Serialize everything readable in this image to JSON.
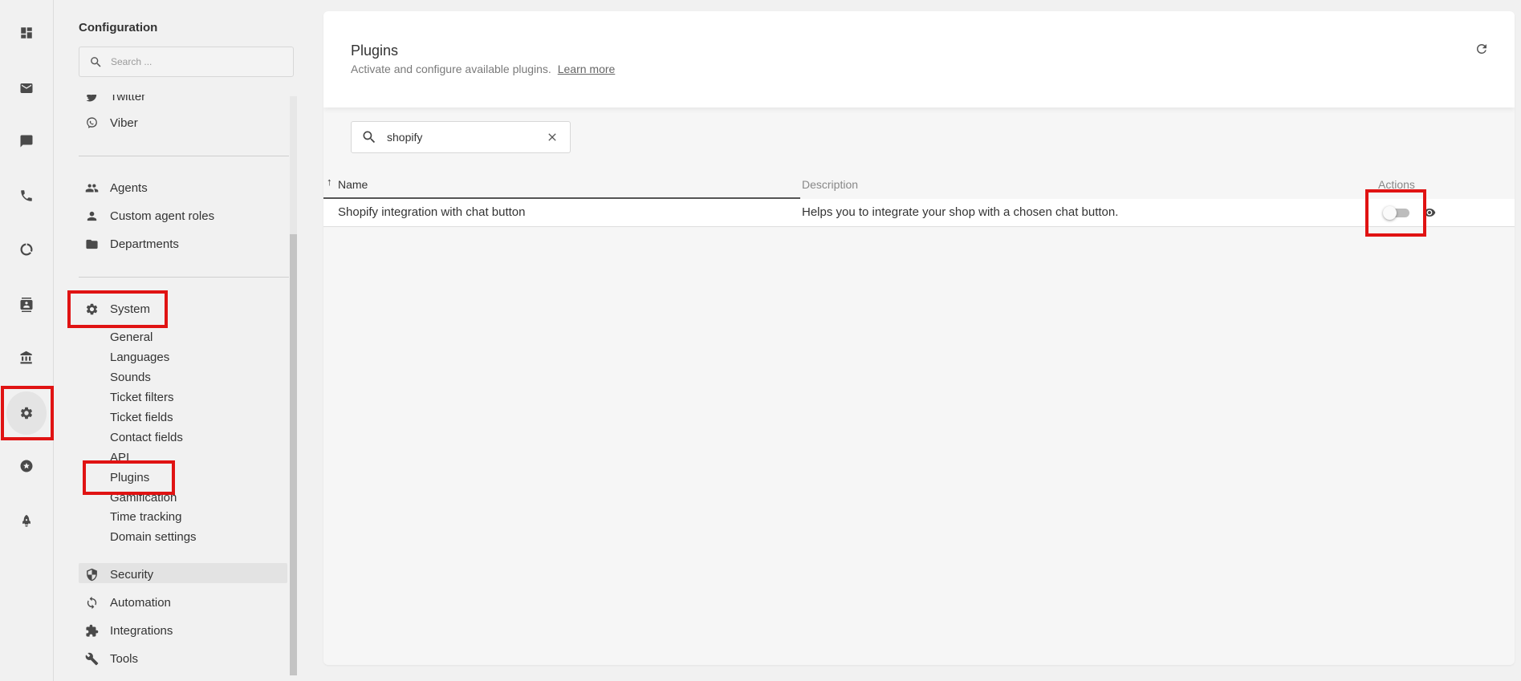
{
  "colors": {
    "accent_highlight": "#e01313",
    "rail_bg": "#f1f1f1",
    "panel_bg": "#ffffff"
  },
  "rail": {
    "items": [
      {
        "icon": "dashboard-icon"
      },
      {
        "icon": "mail-icon"
      },
      {
        "icon": "chat-icon"
      },
      {
        "icon": "phone-icon"
      },
      {
        "icon": "reports-icon"
      },
      {
        "icon": "contacts-icon"
      },
      {
        "icon": "knowledgebase-icon"
      },
      {
        "icon": "gear-icon",
        "active": true
      },
      {
        "icon": "star-icon"
      },
      {
        "icon": "rocket-icon"
      }
    ]
  },
  "sidebar": {
    "title": "Configuration",
    "search_placeholder": "Search ...",
    "channels": [
      {
        "label": "Twitter",
        "icon": "twitter-icon"
      },
      {
        "label": "Viber",
        "icon": "viber-icon"
      }
    ],
    "people": [
      {
        "label": "Agents",
        "icon": "agents-icon"
      },
      {
        "label": "Custom agent roles",
        "icon": "person-icon"
      },
      {
        "label": "Departments",
        "icon": "folder-icon"
      }
    ],
    "system": {
      "label": "System",
      "icon": "gear-icon",
      "children": [
        "General",
        "Languages",
        "Sounds",
        "Ticket filters",
        "Ticket fields",
        "Contact fields",
        "API",
        "Plugins",
        "Gamification",
        "Time tracking",
        "Domain settings"
      ],
      "selected": "Plugins"
    },
    "more": [
      {
        "label": "Security",
        "icon": "shield-icon"
      },
      {
        "label": "Automation",
        "icon": "sync-icon"
      },
      {
        "label": "Integrations",
        "icon": "puzzle-icon"
      },
      {
        "label": "Tools",
        "icon": "wrench-icon"
      }
    ]
  },
  "main": {
    "title": "Plugins",
    "subtitle": "Activate and configure available plugins.",
    "learn_more": "Learn more",
    "filter_value": "shopify",
    "columns": {
      "sort_arrow": "↑",
      "name": "Name",
      "description": "Description",
      "actions": "Actions"
    },
    "rows": [
      {
        "name": "Shopify integration with chat button",
        "description": "Helps you to integrate your shop with a chosen chat button.",
        "enabled": false
      }
    ]
  }
}
